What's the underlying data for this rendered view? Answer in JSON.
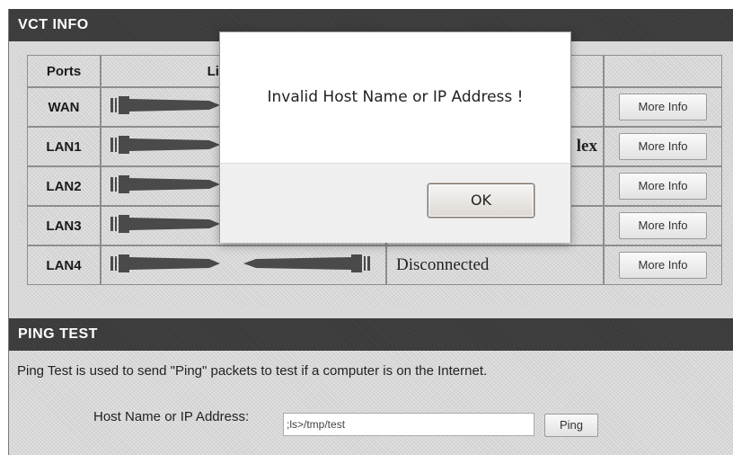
{
  "vct": {
    "title": "VCT INFO",
    "col_ports": "Ports",
    "col_link": "Link Status",
    "col_status": "",
    "col_info": "",
    "rows": [
      {
        "port": "WAN",
        "status": "",
        "button": "More Info"
      },
      {
        "port": "LAN1",
        "status": "lex",
        "button": "More Info"
      },
      {
        "port": "LAN2",
        "status": "",
        "button": "More Info"
      },
      {
        "port": "LAN3",
        "status": "",
        "button": "More Info"
      },
      {
        "port": "LAN4",
        "status": "Disconnected",
        "button": "More Info"
      }
    ]
  },
  "ping": {
    "title": "PING TEST",
    "description": "Ping Test is used to send \"Ping\" packets to test if a computer is on the Internet.",
    "host_label": "Host Name or IP Address:",
    "host_value": ";ls>/tmp/test",
    "ping_button": "Ping"
  },
  "dialog": {
    "message": "Invalid Host Name or IP Address !",
    "ok_label": "OK"
  },
  "colors": {
    "header_bg": "#3a3a3a",
    "panel_bg": "#d6d6d6",
    "cable": "#4a4a4a"
  }
}
